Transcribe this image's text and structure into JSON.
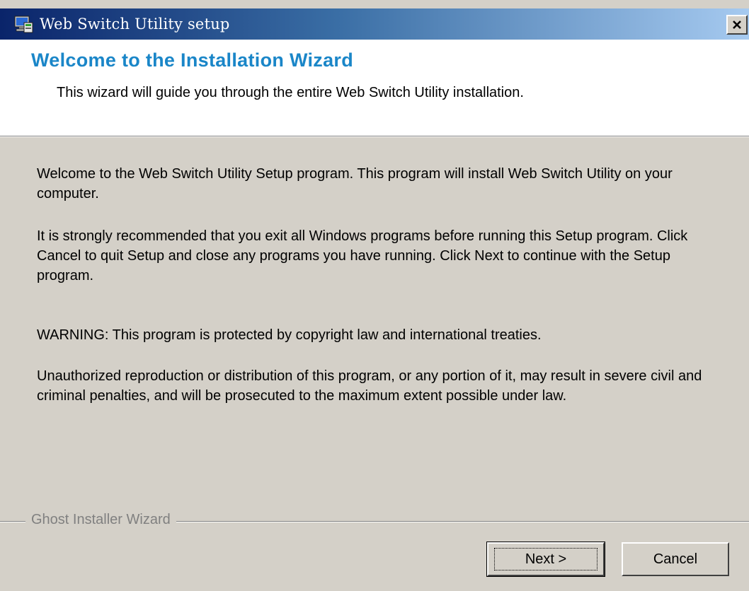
{
  "window": {
    "title": "Web Switch Utility setup",
    "close_symbol": "×"
  },
  "header": {
    "title": "Welcome to the Installation Wizard",
    "subtitle": "This wizard will guide you through the entire Web Switch Utility installation."
  },
  "body": {
    "paragraphs": [
      "Welcome to the Web Switch Utility Setup program. This program will install Web Switch Utility on your computer.",
      "It is strongly recommended that you exit all Windows programs before running this Setup program. Click Cancel to quit Setup and close any programs you have running. Click Next to continue with the Setup program.",
      "WARNING: This program is protected by copyright law and international treaties.",
      "Unauthorized reproduction or distribution of this program, or any portion of it, may result in severe civil and criminal penalties, and will be prosecuted to the maximum extent possible under law."
    ]
  },
  "footer": {
    "brand": "Ghost Installer Wizard",
    "next_label": "Next >",
    "cancel_label": "Cancel"
  },
  "colors": {
    "title_accent": "#1a86c8",
    "dialog_bg": "#d4d0c8",
    "titlebar_start": "#0a246a"
  },
  "icons": {
    "app": "setup-computer-icon",
    "close": "close-icon"
  }
}
